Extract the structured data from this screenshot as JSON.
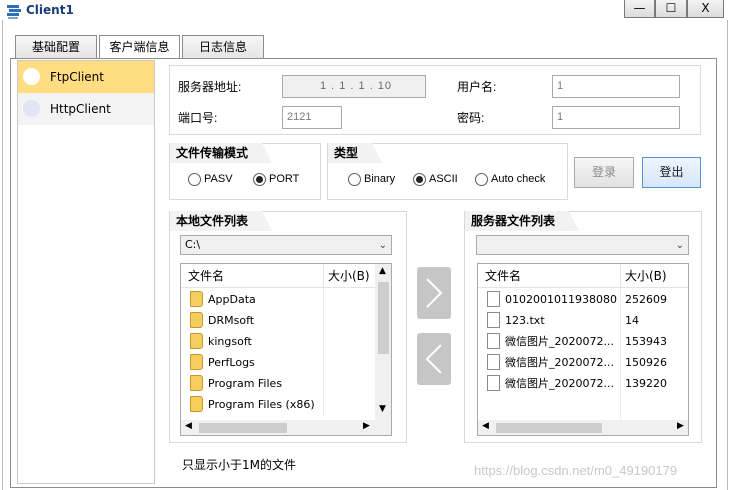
{
  "window": {
    "title": "Client1",
    "minimize": "—",
    "maximize": "☐",
    "close": "X"
  },
  "tabs": [
    "基础配置",
    "客户端信息",
    "日志信息"
  ],
  "left_list": [
    "FtpClient",
    "HttpClient"
  ],
  "connection": {
    "server_label": "服务器地址:",
    "server_value": "1 . 1 . 1 . 10",
    "port_label": "端口号:",
    "port_value": "2121",
    "user_label": "用户名:",
    "user_value": "1",
    "pass_label": "密码:",
    "pass_value": "1"
  },
  "transfer_mode": {
    "title": "文件传输模式",
    "options": [
      "PASV",
      "PORT"
    ],
    "selected": "PORT"
  },
  "type_group": {
    "title": "类型",
    "options": [
      "Binary",
      "ASCII",
      "Auto check"
    ],
    "selected": "ASCII"
  },
  "buttons": {
    "login": "登录",
    "logout": "登出"
  },
  "local_files": {
    "title": "本地文件列表",
    "path": "C:\\",
    "col_name": "文件名",
    "col_size": "大小(B)",
    "rows": [
      {
        "name": "AppData",
        "size": ""
      },
      {
        "name": "DRMsoft",
        "size": ""
      },
      {
        "name": "kingsoft",
        "size": ""
      },
      {
        "name": "PerfLogs",
        "size": ""
      },
      {
        "name": "Program Files",
        "size": ""
      },
      {
        "name": "Program Files (x86)",
        "size": ""
      }
    ]
  },
  "server_files": {
    "title": "服务器文件列表",
    "path": "",
    "col_name": "文件名",
    "col_size": "大小(B)",
    "rows": [
      {
        "name": "0102001011938080...",
        "size": "252609"
      },
      {
        "name": "123.txt",
        "size": "14"
      },
      {
        "name": "微信图片_2020072...",
        "size": "153943"
      },
      {
        "name": "微信图片_2020072...",
        "size": "150926"
      },
      {
        "name": "微信图片_2020072...",
        "size": "139220"
      }
    ]
  },
  "note": "只显示小于1M的文件",
  "watermark": "https://blog.csdn.net/m0_49190179",
  "colors": {
    "selected_item": "#ffdd80",
    "logout_border": "#5a8fd0",
    "title_text": "#1a3c78"
  }
}
